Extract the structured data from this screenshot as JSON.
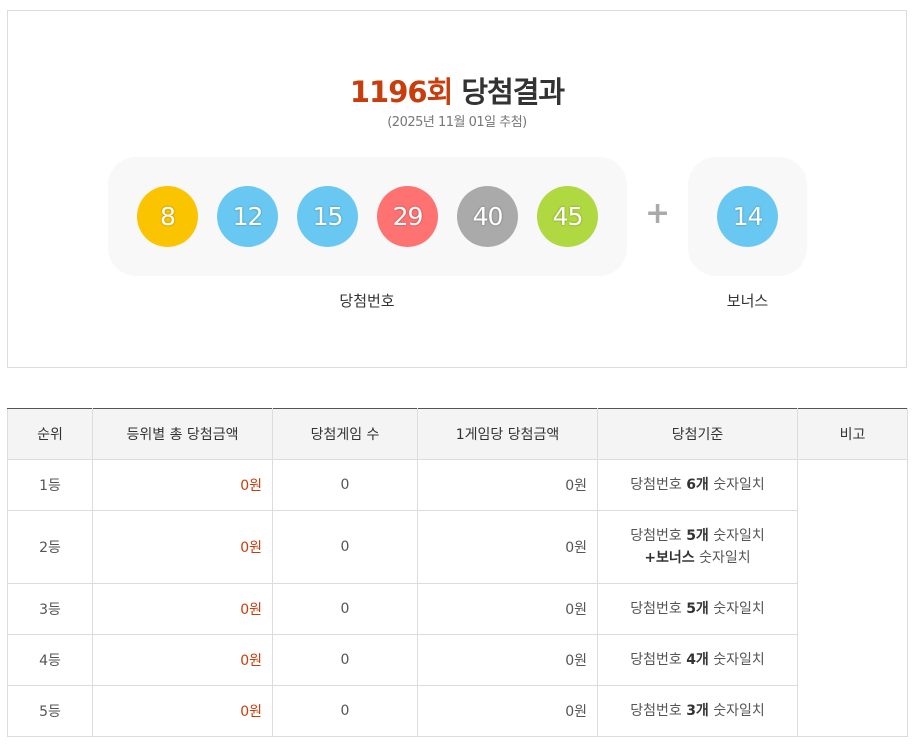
{
  "draw": {
    "round_number": "1196회",
    "title_suffix": "당첨결과",
    "date_text": "(2025년 11월 01일 추첨)"
  },
  "balls": [
    {
      "number": "8",
      "color": "#fbc400"
    },
    {
      "number": "12",
      "color": "#69c8f2"
    },
    {
      "number": "15",
      "color": "#69c8f2"
    },
    {
      "number": "29",
      "color": "#ff7272"
    },
    {
      "number": "40",
      "color": "#aaaaaa"
    },
    {
      "number": "45",
      "color": "#b0d840"
    }
  ],
  "bonus": {
    "number": "14",
    "color": "#69c8f2"
  },
  "plus_symbol": "+",
  "labels": {
    "winning_numbers": "당첨번호",
    "bonus": "보너스"
  },
  "table": {
    "headers": [
      "순위",
      "등위별 총 당첨금액",
      "당첨게임 수",
      "1게임당 당첨금액",
      "당첨기준",
      "비고"
    ],
    "rows": [
      {
        "rank": "1등",
        "total": "0원",
        "games": "0",
        "per_game": "0원",
        "crit_a": "당첨번호 ",
        "crit_b": "6개",
        "crit_c": " 숫자일치",
        "crit_d": "",
        "crit_e": ""
      },
      {
        "rank": "2등",
        "total": "0원",
        "games": "0",
        "per_game": "0원",
        "crit_a": "당첨번호 ",
        "crit_b": "5개",
        "crit_c": " 숫자일치",
        "crit_d": "+보너스",
        "crit_e": " 숫자일치"
      },
      {
        "rank": "3등",
        "total": "0원",
        "games": "0",
        "per_game": "0원",
        "crit_a": "당첨번호 ",
        "crit_b": "5개",
        "crit_c": " 숫자일치",
        "crit_d": "",
        "crit_e": ""
      },
      {
        "rank": "4등",
        "total": "0원",
        "games": "0",
        "per_game": "0원",
        "crit_a": "당첨번호 ",
        "crit_b": "4개",
        "crit_c": " 숫자일치",
        "crit_d": "",
        "crit_e": ""
      },
      {
        "rank": "5등",
        "total": "0원",
        "games": "0",
        "per_game": "0원",
        "crit_a": "당첨번호 ",
        "crit_b": "3개",
        "crit_c": " 숫자일치",
        "crit_d": "",
        "crit_e": ""
      }
    ],
    "notes": ""
  },
  "colors": {
    "accent_red": "#c83d0c",
    "panel_bg": "#f8f8f8",
    "header_bg": "#f4f4f4"
  }
}
